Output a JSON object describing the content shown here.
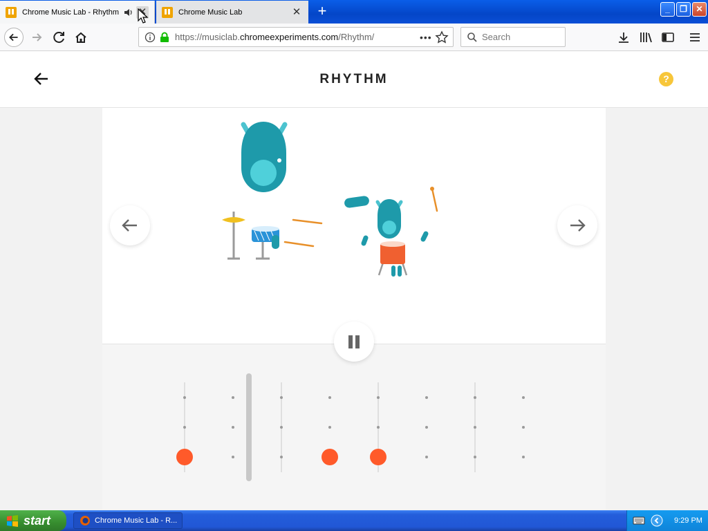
{
  "tabs": [
    {
      "title": "Chrome Music Lab - Rhythm",
      "active": true,
      "playing_audio": true
    },
    {
      "title": "Chrome Music Lab",
      "active": false
    }
  ],
  "navbar": {
    "url_scheme": "https://musiclab.",
    "url_domain": "chromeexperiments.com",
    "url_path": "/Rhythm/",
    "search_placeholder": "Search"
  },
  "page": {
    "title": "RHYTHM",
    "help_label": "?"
  },
  "colors": {
    "accent_orange": "#ff5a2a",
    "monster_teal": "#1e9aaa",
    "help_yellow": "#f7c63a"
  },
  "sequencer": {
    "columns": 8,
    "rows": 3,
    "current_column": 2,
    "active_notes": [
      {
        "column": 1,
        "row": 3
      },
      {
        "column": 4,
        "row": 3
      },
      {
        "column": 5,
        "row": 3
      }
    ]
  },
  "taskbar": {
    "start_label": "start",
    "task_item": "Chrome Music Lab - R...",
    "clock": "9:29 PM"
  }
}
